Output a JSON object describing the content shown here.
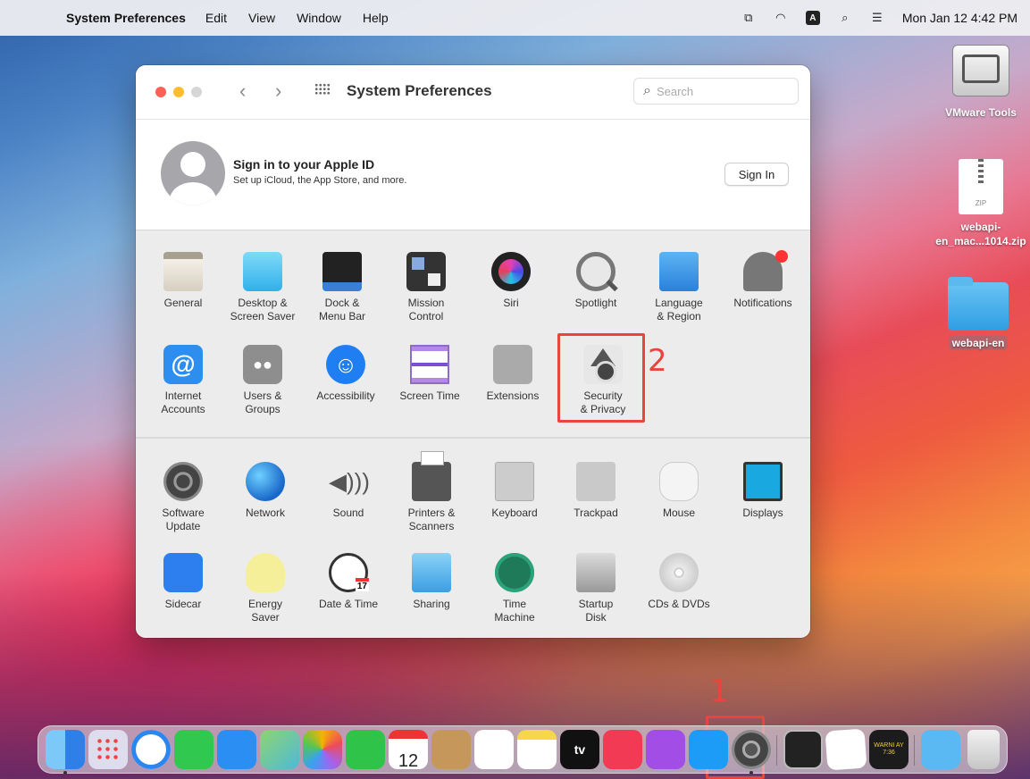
{
  "menubar": {
    "app_name": "System Preferences",
    "items": [
      "Edit",
      "View",
      "Window",
      "Help"
    ],
    "clock": "Mon Jan 12  4:42 PM",
    "input_source": "A"
  },
  "desktop": {
    "items": [
      {
        "label": "VMware Tools",
        "icon": "drive-icon"
      },
      {
        "label": "webapi-\nen_mac...1014.zip",
        "label_line1": "webapi-",
        "label_line2": "en_mac...1014.zip",
        "icon": "zip-file-icon",
        "badge": "ZIP"
      },
      {
        "label": "webapi-en",
        "icon": "folder-icon"
      }
    ]
  },
  "window": {
    "title": "System Preferences",
    "search_placeholder": "Search",
    "account": {
      "title": "Sign in to your Apple ID",
      "subtitle": "Set up iCloud, the App Store, and more.",
      "button": "Sign In"
    },
    "row1": [
      {
        "label": "General",
        "icon": "general-icon"
      },
      {
        "label": "Desktop &\nScreen Saver",
        "l1": "Desktop &",
        "l2": "Screen Saver",
        "icon": "desktop-icon"
      },
      {
        "l1": "Dock &",
        "l2": "Menu Bar",
        "icon": "dock-icon"
      },
      {
        "l1": "Mission",
        "l2": "Control",
        "icon": "mission-control-icon"
      },
      {
        "label": "Siri",
        "icon": "siri-icon"
      },
      {
        "label": "Spotlight",
        "icon": "spotlight-icon"
      },
      {
        "l1": "Language",
        "l2": "& Region",
        "icon": "globe-flag-icon"
      },
      {
        "label": "Notifications",
        "icon": "bell-icon"
      }
    ],
    "row2": [
      {
        "l1": "Internet",
        "l2": "Accounts",
        "icon": "at-sign-icon",
        "glyph": "@"
      },
      {
        "l1": "Users &",
        "l2": "Groups",
        "icon": "users-icon"
      },
      {
        "label": "Accessibility",
        "icon": "accessibility-icon"
      },
      {
        "label": "Screen Time",
        "icon": "hourglass-icon"
      },
      {
        "label": "Extensions",
        "icon": "puzzle-icon"
      },
      {
        "l1": "Security",
        "l2": "& Privacy",
        "icon": "house-lock-icon"
      }
    ],
    "row3": [
      {
        "l1": "Software",
        "l2": "Update",
        "icon": "gear-icon"
      },
      {
        "label": "Network",
        "icon": "globe-icon"
      },
      {
        "label": "Sound",
        "icon": "speaker-icon"
      },
      {
        "l1": "Printers &",
        "l2": "Scanners",
        "icon": "printer-icon"
      },
      {
        "label": "Keyboard",
        "icon": "keyboard-icon"
      },
      {
        "label": "Trackpad",
        "icon": "trackpad-icon"
      },
      {
        "label": "Mouse",
        "icon": "mouse-icon"
      },
      {
        "label": "Displays",
        "icon": "display-icon"
      }
    ],
    "row4": [
      {
        "label": "Sidecar",
        "icon": "sidecar-icon"
      },
      {
        "l1": "Energy",
        "l2": "Saver",
        "icon": "lightbulb-icon"
      },
      {
        "label": "Date & Time",
        "icon": "clock-calendar-icon"
      },
      {
        "label": "Sharing",
        "icon": "sharing-folder-icon"
      },
      {
        "l1": "Time",
        "l2": "Machine",
        "icon": "time-machine-icon"
      },
      {
        "l1": "Startup",
        "l2": "Disk",
        "icon": "disk-icon"
      },
      {
        "label": "CDs & DVDs",
        "icon": "cd-icon"
      }
    ]
  },
  "annotations": {
    "step1": "1",
    "step2": "2",
    "color": "#e8453c"
  },
  "dock": {
    "calendar_day": "12",
    "calendar_month": "JAN",
    "tv_label": "tv",
    "console_text": "WARNI\nAY 7:36",
    "apps": [
      "finder-icon",
      "launchpad-icon",
      "safari-icon",
      "messages-icon",
      "mail-icon",
      "maps-icon",
      "photos-icon",
      "facetime-icon",
      "calendar-icon",
      "contacts-icon",
      "reminders-icon",
      "notes-icon",
      "apple-tv-icon",
      "music-icon",
      "podcasts-icon",
      "app-store-icon",
      "system-preferences-icon",
      "terminal-icon",
      "textedit-icon",
      "console-icon",
      "downloads-folder-icon",
      "trash-icon"
    ]
  }
}
